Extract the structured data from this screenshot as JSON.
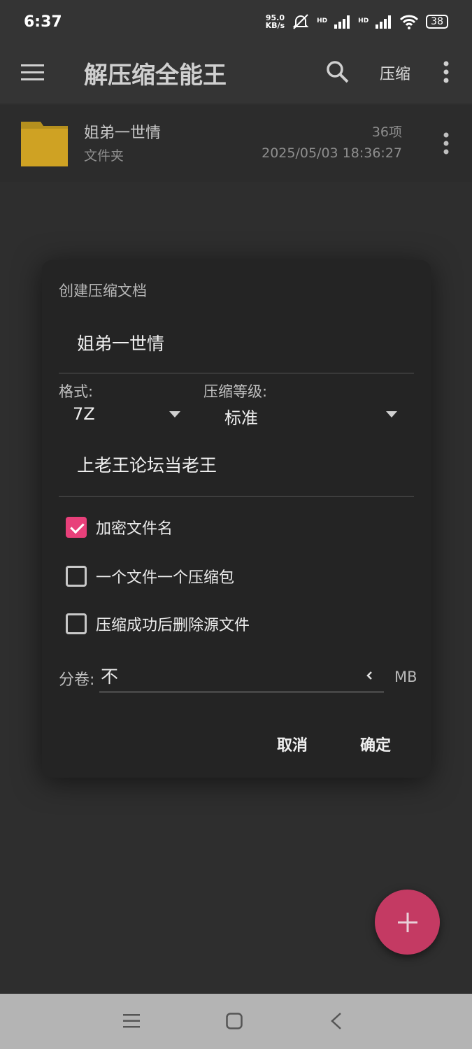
{
  "status_bar": {
    "time": "6:37",
    "net_speed_value": "95.0",
    "net_speed_unit": "KB/s",
    "hd_label_1": "HD",
    "hd_label_2": "HD",
    "battery": "38"
  },
  "app_bar": {
    "title": "解压缩全能王",
    "compress_label": "压缩",
    "icons": [
      "menu-icon",
      "search-icon",
      "more-vert-icon"
    ]
  },
  "file_list": [
    {
      "name": "姐弟一世情",
      "type": "文件夹",
      "count": "36项",
      "date": "2025/05/03 18:36:27",
      "icon": "folder-icon"
    }
  ],
  "dialog": {
    "title": "创建压缩文档",
    "archive_name": "姐弟一世情",
    "format_label": "格式:",
    "format_value": "7Z",
    "level_label": "压缩等级:",
    "level_value": "标准",
    "password": "上老王论坛当老王",
    "options": [
      {
        "label": "加密文件名",
        "checked": true
      },
      {
        "label": "一个文件一个压缩包",
        "checked": false
      },
      {
        "label": "压缩成功后删除源文件",
        "checked": false
      }
    ],
    "split_label": "分卷:",
    "split_value": "不",
    "split_unit": "MB",
    "cancel_label": "取消",
    "ok_label": "确定"
  },
  "colors": {
    "accent": "#e8407a",
    "fab": "#c43a63",
    "background": "#2e2e2e",
    "dialog": "#242424",
    "nav_bar": "#b4b4b4"
  }
}
